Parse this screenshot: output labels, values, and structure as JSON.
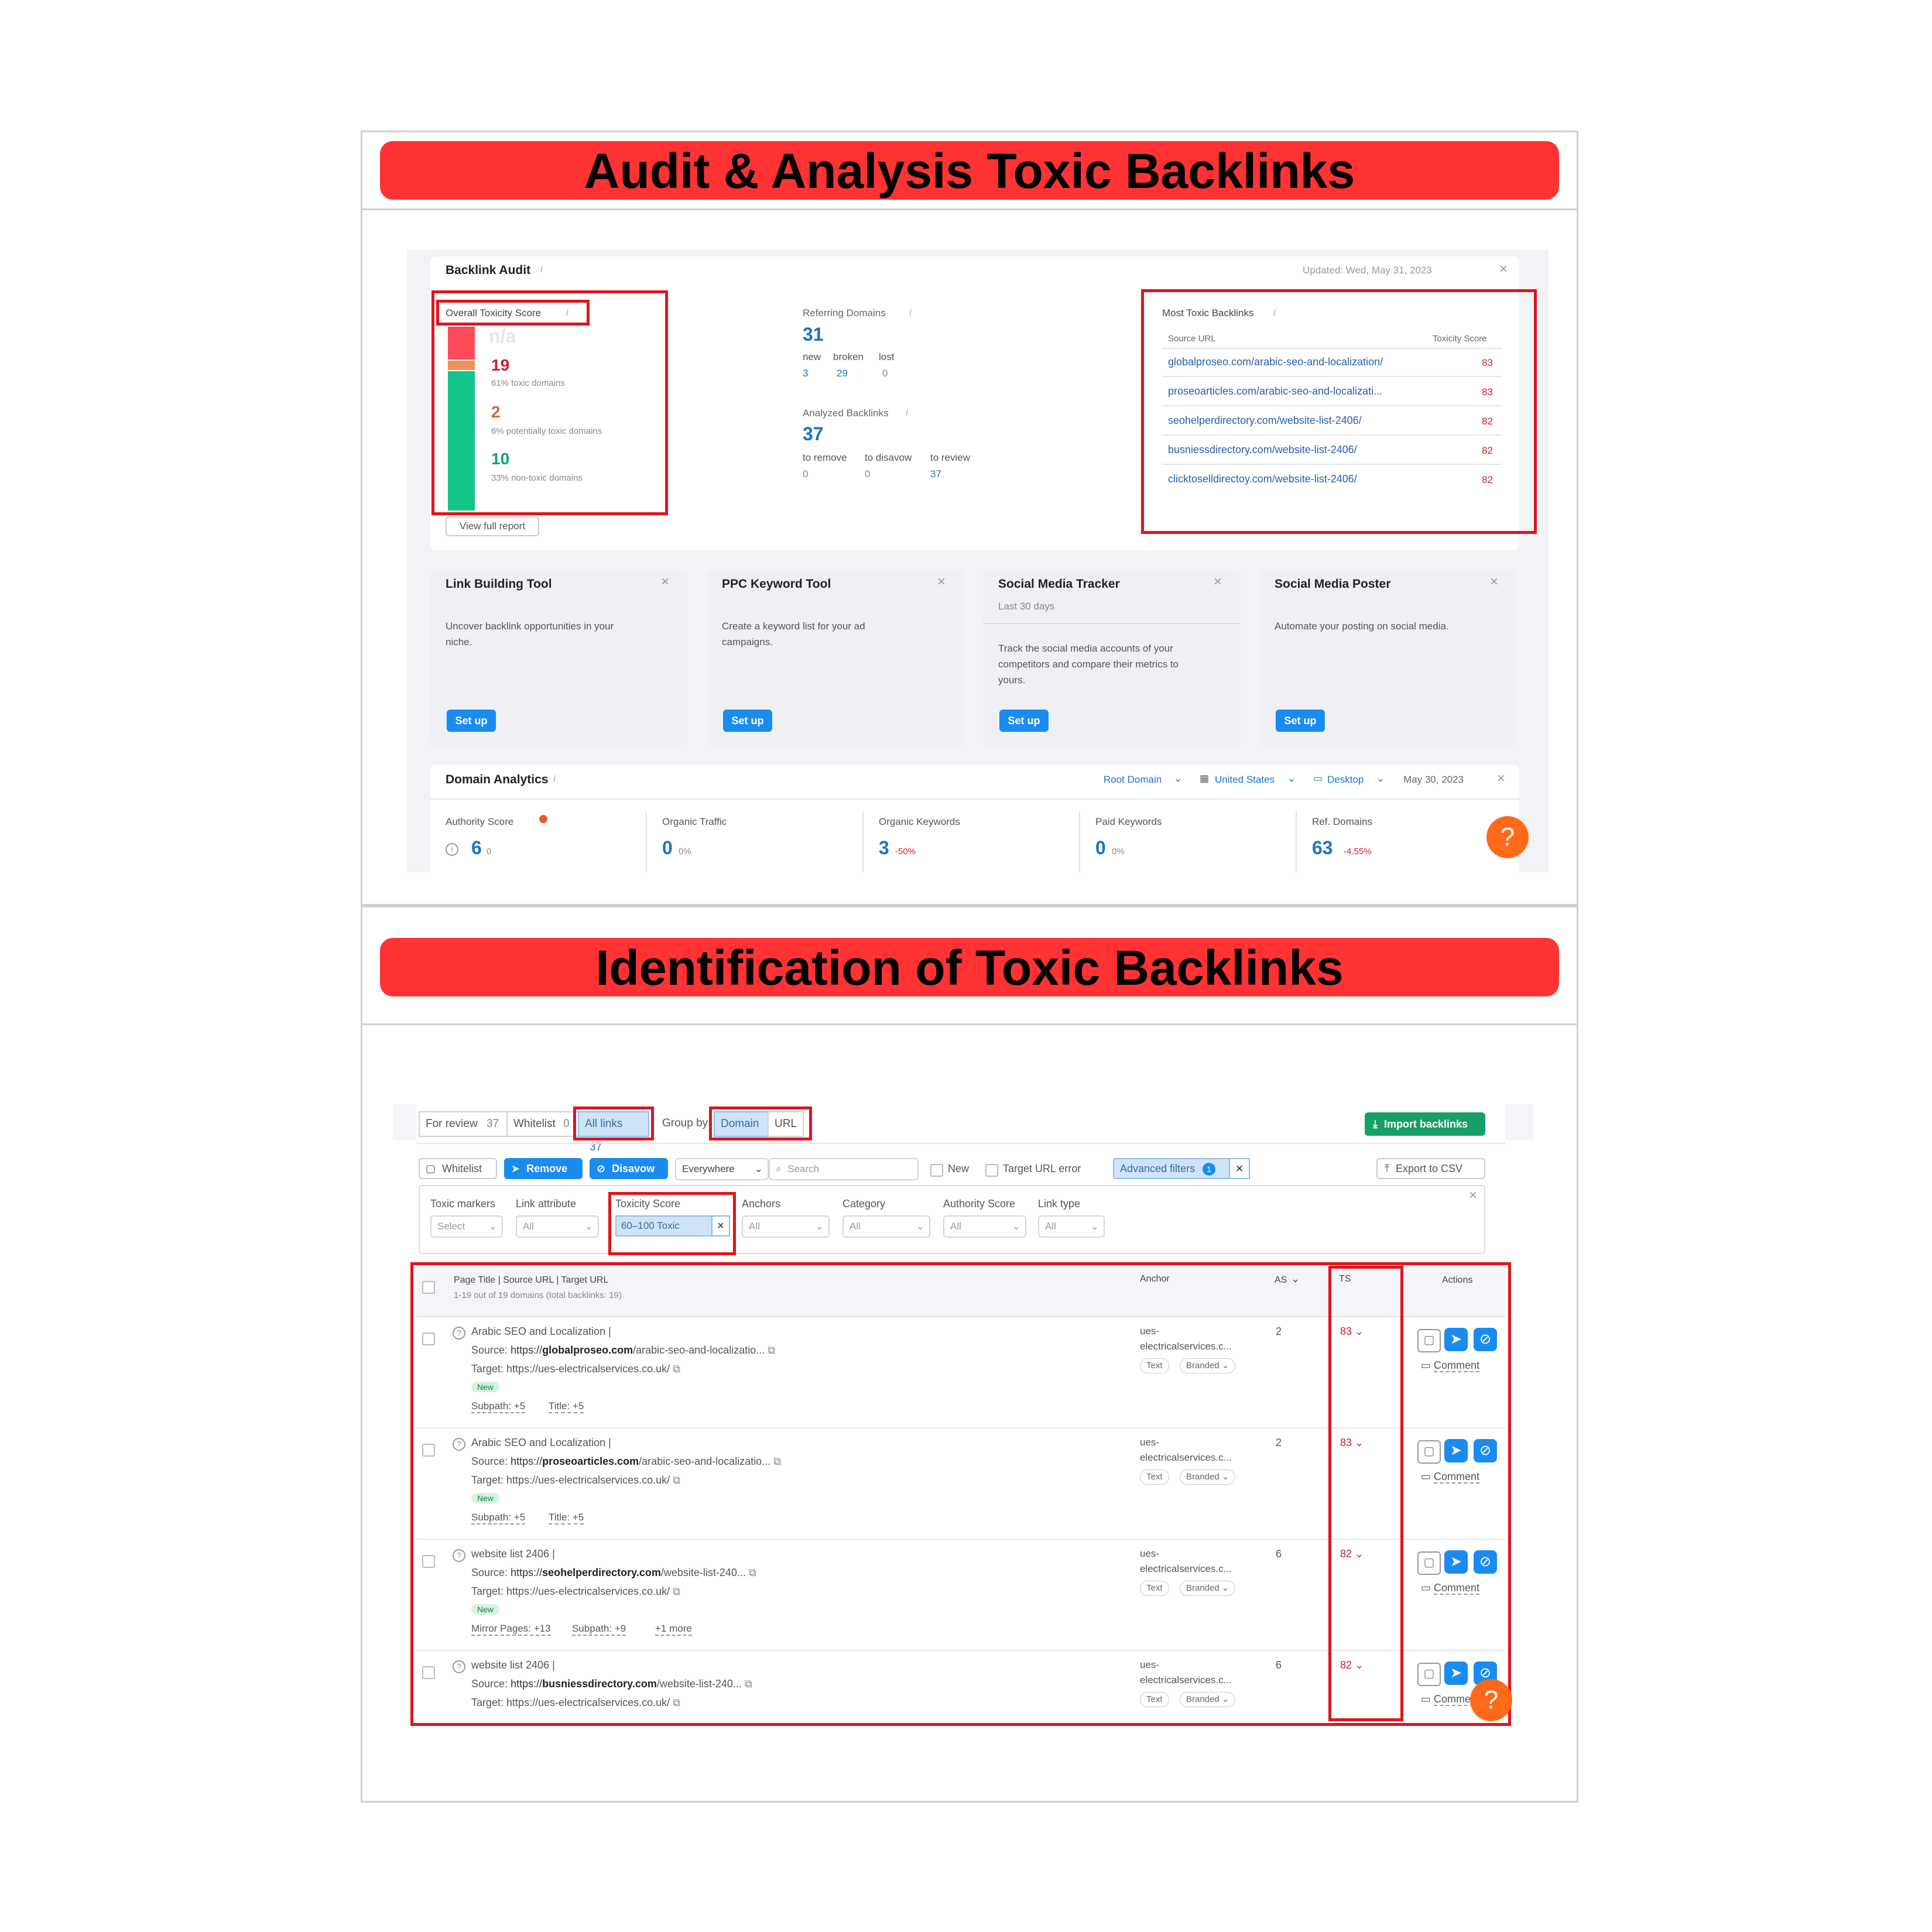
{
  "banners": {
    "top": "Audit & Analysis Toxic Backlinks",
    "bottom": "Identification of Toxic Backlinks"
  },
  "backlink_audit": {
    "title": "Backlink Audit",
    "updated": "Updated: Wed, May 31, 2023",
    "overall_label": "Overall Toxicity Score",
    "overall_value": "n/a",
    "toxic_count": "19",
    "toxic_desc": "61% toxic domains",
    "potential_count": "2",
    "potential_desc": "6% potentially toxic domains",
    "nontoxic_count": "10",
    "nontoxic_desc": "33% non-toxic domains",
    "view_full_report": "View full report",
    "referring_domains_label": "Referring Domains",
    "referring_domains_value": "31",
    "rd_new_label": "new",
    "rd_broken_label": "broken",
    "rd_lost_label": "lost",
    "rd_new": "3",
    "rd_broken": "29",
    "rd_lost": "0",
    "analyzed_label": "Analyzed Backlinks",
    "analyzed_value": "37",
    "to_remove_label": "to remove",
    "to_disavow_label": "to disavow",
    "to_review_label": "to review",
    "to_remove": "0",
    "to_disavow": "0",
    "to_review": "37",
    "most_toxic_label": "Most Toxic Backlinks",
    "col_source": "Source URL",
    "col_score": "Toxicity Score",
    "toxic_rows": [
      {
        "url": "globalproseo.com/arabic-seo-and-localization/",
        "score": "83"
      },
      {
        "url": "proseoarticles.com/arabic-seo-and-localizati...",
        "score": "83"
      },
      {
        "url": "seohelperdirectory.com/website-list-2406/",
        "score": "82"
      },
      {
        "url": "busniessdirectory.com/website-list-2406/",
        "score": "82"
      },
      {
        "url": "clicktoselldirectoy.com/website-list-2406/",
        "score": "82"
      }
    ]
  },
  "tools": [
    {
      "title": "Link Building Tool",
      "sub": "",
      "desc1": "Uncover backlink opportunities in your",
      "desc2": "niche.",
      "desc3": "",
      "btn": "Set up"
    },
    {
      "title": "PPC Keyword Tool",
      "sub": "",
      "desc1": "Create a keyword list for your ad",
      "desc2": "campaigns.",
      "desc3": "",
      "btn": "Set up"
    },
    {
      "title": "Social Media Tracker",
      "sub": "Last 30 days",
      "desc1": "Track the social media accounts of your",
      "desc2": "competitors and compare their metrics to",
      "desc3": "yours.",
      "btn": "Set up"
    },
    {
      "title": "Social Media Poster",
      "sub": "",
      "desc1": "Automate your posting on social media.",
      "desc2": "",
      "desc3": "",
      "btn": "Set up"
    }
  ],
  "domain_analytics": {
    "title": "Domain Analytics",
    "root_domain": "Root Domain",
    "country": "United States",
    "device": "Desktop",
    "date": "May 30, 2023",
    "metrics": [
      {
        "label": "Authority Score",
        "value": "6",
        "delta": "0"
      },
      {
        "label": "Organic Traffic",
        "value": "0",
        "delta": "0%"
      },
      {
        "label": "Organic Keywords",
        "value": "3",
        "delta": "-50%"
      },
      {
        "label": "Paid Keywords",
        "value": "0",
        "delta": "0%"
      },
      {
        "label": "Ref. Domains",
        "value": "63",
        "delta": "-4.55%"
      }
    ]
  },
  "filters_bar": {
    "for_review": "For review",
    "for_review_count": "37",
    "whitelist_tab": "Whitelist",
    "whitelist_count": "0",
    "all_links": "All links",
    "all_links_count": "37",
    "group_by": "Group by",
    "group_domain": "Domain",
    "group_url": "URL",
    "import": "Import backlinks",
    "whitelist_btn": "Whitelist",
    "remove_btn": "Remove",
    "disavow_btn": "Disavow",
    "everywhere": "Everywhere",
    "search_placeholder": "Search",
    "new_label": "New",
    "target_error_label": "Target URL error",
    "advanced": "Advanced filters",
    "advanced_count": "1",
    "export": "Export to CSV"
  },
  "adv_filters": {
    "toxic_markers": "Toxic markers",
    "toxic_markers_val": "Select",
    "link_attribute": "Link attribute",
    "link_attribute_val": "All",
    "toxicity_score": "Toxicity Score",
    "toxicity_score_val": "60–100 Toxic",
    "anchors": "Anchors",
    "anchors_val": "All",
    "category": "Category",
    "category_val": "All",
    "authority_score": "Authority Score",
    "authority_score_val": "All",
    "link_type": "Link type",
    "link_type_val": "All"
  },
  "table": {
    "col_page": "Page Title | Source URL | Target URL",
    "summary": "1-19 out of 19 domains (total backlinks: 19)",
    "col_anchor": "Anchor",
    "col_as": "AS",
    "col_ts": "TS",
    "col_actions": "Actions",
    "source_label": "Source:",
    "target_label": "Target:",
    "new_badge": "New",
    "comment": "Comment",
    "anchor1": "ues-",
    "anchor2": "electricalservices.c...",
    "chip_text": "Text",
    "chip_branded": "Branded",
    "rows": [
      {
        "title": "Arabic SEO and Localization |",
        "src_pre": "https://",
        "src_bold": "globalproseo.com",
        "src_post": "/arabic-seo-and-localizatio...",
        "target": "https://ues-electricalservices.co.uk/",
        "extra1": "Subpath: +5",
        "extra2": "Title: +5",
        "extra3": "",
        "as": "2",
        "ts": "83"
      },
      {
        "title": "Arabic SEO and Localization |",
        "src_pre": "https://",
        "src_bold": "proseoarticles.com",
        "src_post": "/arabic-seo-and-localizatio...",
        "target": "https://ues-electricalservices.co.uk/",
        "extra1": "Subpath: +5",
        "extra2": "Title: +5",
        "extra3": "",
        "as": "2",
        "ts": "83"
      },
      {
        "title": "website list 2406 |",
        "src_pre": "https://",
        "src_bold": "seohelperdirectory.com",
        "src_post": "/website-list-240...",
        "target": "https://ues-electricalservices.co.uk/",
        "extra1": "Mirror Pages: +13",
        "extra2": "Subpath: +9",
        "extra3": "+1 more",
        "as": "6",
        "ts": "82"
      },
      {
        "title": "website list 2406 |",
        "src_pre": "https://",
        "src_bold": "busniessdirectory.com",
        "src_post": "/website-list-240...",
        "target": "https://ues-electricalservices.co.uk/",
        "extra1": "",
        "extra2": "",
        "extra3": "",
        "as": "6",
        "ts": "82"
      }
    ]
  },
  "colors": {
    "banner": "#ff3333",
    "highlight": "#e0141e",
    "accent": "#1a8cf0",
    "toxic": "#c8202e",
    "potential": "#e0603a",
    "nontoxic": "#13a07a"
  }
}
